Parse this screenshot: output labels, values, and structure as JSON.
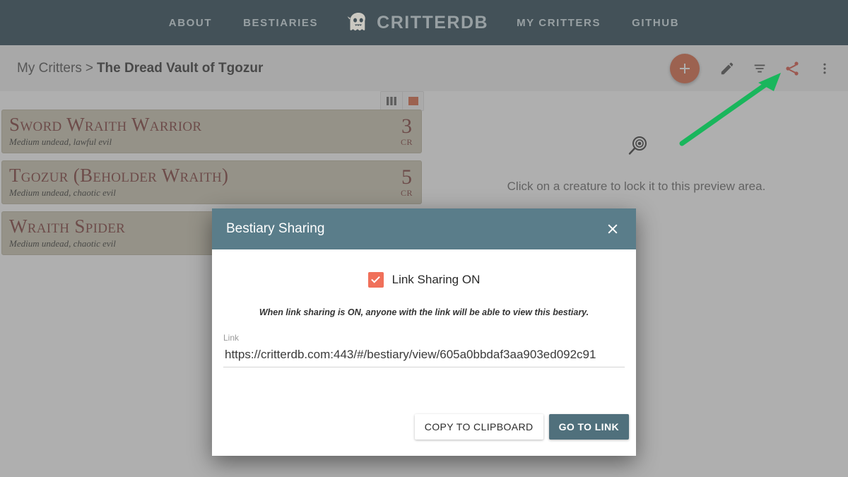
{
  "navbar": {
    "brand": {
      "text": "CritterDB",
      "icon": "ghost-icon"
    },
    "links": [
      {
        "label": "About"
      },
      {
        "label": "Bestiaries"
      },
      {
        "label": "My Critters"
      },
      {
        "label": "GitHub"
      }
    ]
  },
  "subheader": {
    "breadcrumb": {
      "parent": "My Critters",
      "separator": ">",
      "current": "The Dread Vault of Tgozur"
    },
    "toolbar": {
      "add": {
        "label": "+",
        "name": "add-creature-button",
        "color": "#d4542e"
      },
      "edit": {
        "name": "edit-icon"
      },
      "filter": {
        "name": "filter-icon"
      },
      "share": {
        "name": "share-icon",
        "color": "#d43f2e"
      },
      "more": {
        "name": "more-vertical-icon"
      }
    }
  },
  "list": {
    "view_toggles": [
      {
        "name": "columns-view-icon",
        "active": false
      },
      {
        "name": "single-view-icon",
        "active": true
      }
    ],
    "creatures": [
      {
        "name": "Sword Wraith Warrior",
        "meta": "Medium undead, lawful evil",
        "cr": "3",
        "cr_label": "CR"
      },
      {
        "name": "Tgozur (Beholder Wraith)",
        "meta": "Medium undead, chaotic evil",
        "cr": "5",
        "cr_label": "CR"
      },
      {
        "name": "Wraith Spider",
        "meta": "Medium undead, chaotic evil",
        "cr": "",
        "cr_label": ""
      }
    ]
  },
  "preview": {
    "icon": "magnifier-icon",
    "message": "Click on a creature to lock it to this preview area."
  },
  "dialog": {
    "title": "Bestiary Sharing",
    "close_icon": "close-icon",
    "checkbox": {
      "checked": true,
      "label": "Link Sharing ON",
      "color": "#f0705a"
    },
    "helper_text": "When link sharing is ON, anyone with the link will be able to view this bestiary.",
    "link_field": {
      "label": "Link",
      "value": "https://critterdb.com:443/#/bestiary/view/605a0bbdaf3aa903ed092c91",
      "placeholder": "Link"
    },
    "buttons": {
      "copy": "COPY TO CLIPBOARD",
      "goto": "GO TO LINK"
    }
  },
  "annotation": {
    "arrow": {
      "name": "green-arrow-annotation",
      "color": "#19b65c"
    }
  }
}
